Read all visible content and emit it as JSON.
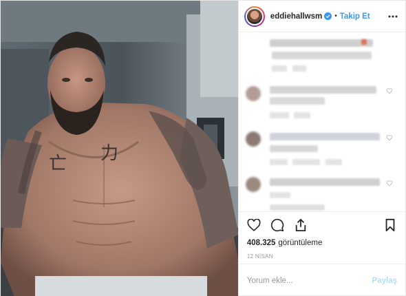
{
  "header": {
    "username": "eddiehallwsm",
    "separator": "•",
    "follow_label": "Takip Et"
  },
  "media": {
    "chest_text_left": "亡",
    "chest_text_right": "力"
  },
  "stats": {
    "views_count": "408.325",
    "views_label": "görüntüleme",
    "date": "12 NİSAN"
  },
  "comment": {
    "placeholder": "Yorum ekle...",
    "post_label": "Paylaş"
  },
  "colors": {
    "accent": "#3897f0",
    "disabled_accent": "#b2dffc"
  }
}
